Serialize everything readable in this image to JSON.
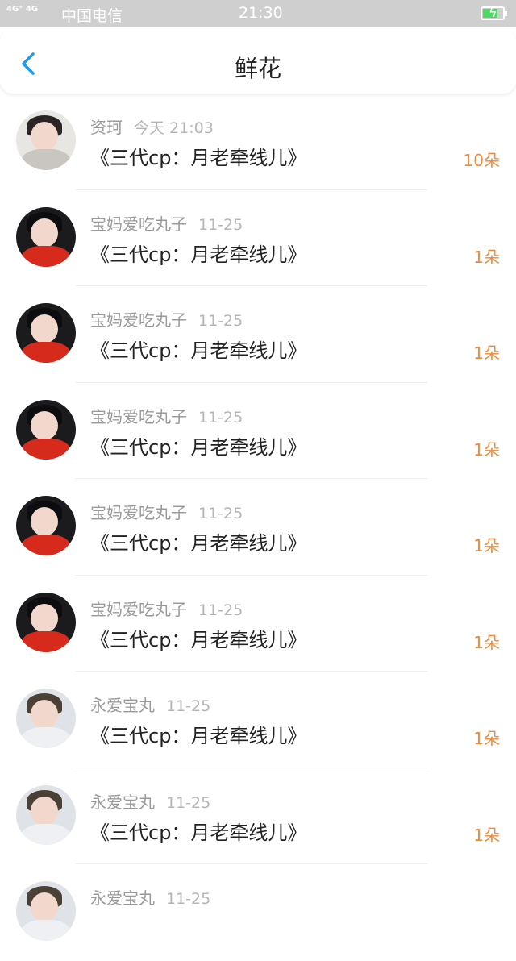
{
  "status_bar": {
    "signal": "4G⁺ 4G",
    "carrier": "中国电信",
    "time": "21:30"
  },
  "header": {
    "title": "鲜花"
  },
  "items": [
    {
      "name": "资珂",
      "time": "今天 21:03",
      "work": "《三代cp：月老牵线儿》",
      "count": "10朵",
      "avatar": "av-a"
    },
    {
      "name": "宝妈爱吃丸子",
      "time": "11-25",
      "work": "《三代cp：月老牵线儿》",
      "count": "1朵",
      "avatar": "av-b"
    },
    {
      "name": "宝妈爱吃丸子",
      "time": "11-25",
      "work": "《三代cp：月老牵线儿》",
      "count": "1朵",
      "avatar": "av-b"
    },
    {
      "name": "宝妈爱吃丸子",
      "time": "11-25",
      "work": "《三代cp：月老牵线儿》",
      "count": "1朵",
      "avatar": "av-b"
    },
    {
      "name": "宝妈爱吃丸子",
      "time": "11-25",
      "work": "《三代cp：月老牵线儿》",
      "count": "1朵",
      "avatar": "av-b"
    },
    {
      "name": "宝妈爱吃丸子",
      "time": "11-25",
      "work": "《三代cp：月老牵线儿》",
      "count": "1朵",
      "avatar": "av-b"
    },
    {
      "name": "永爱宝丸",
      "time": "11-25",
      "work": "《三代cp：月老牵线儿》",
      "count": "1朵",
      "avatar": "av-c"
    },
    {
      "name": "永爱宝丸",
      "time": "11-25",
      "work": "《三代cp：月老牵线儿》",
      "count": "1朵",
      "avatar": "av-c"
    },
    {
      "name": "永爱宝丸",
      "time": "11-25",
      "work": "",
      "count": "",
      "avatar": "av-c"
    }
  ],
  "colors": {
    "accent": "#1e9bf0",
    "flower_count": "#f08a3a"
  }
}
